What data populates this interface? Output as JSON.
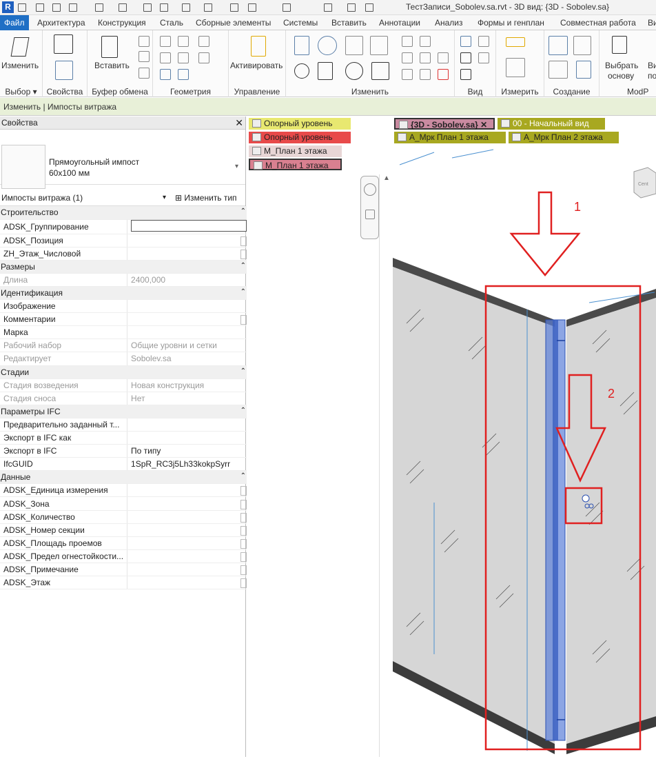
{
  "app": {
    "title": "ТестЗаписи_Sobolev.sa.rvt - 3D вид: {3D - Sobolev.sa}"
  },
  "tabs": [
    "Файл",
    "Архитектура",
    "Конструкция",
    "Сталь",
    "Сборные элементы",
    "Системы",
    "Вставить",
    "Аннотации",
    "Анализ",
    "Формы и генплан",
    "Совместная работа",
    "Ви"
  ],
  "ribbon": {
    "modify_label": "Изменить",
    "paste_label": "Вставить",
    "activate_label": "Активировать",
    "select_base_label1": "Выбрать",
    "select_base_label2": "основу",
    "vi_label1": "Ви",
    "vi_label2": "под",
    "panels": [
      "Выбор ▾",
      "Свойства",
      "Буфер обмена",
      "Геометрия",
      "Управление",
      "Изменить",
      "Вид",
      "Измерить",
      "Создание",
      "ModP"
    ]
  },
  "context_bar": "Изменить | Импосты витража",
  "properties": {
    "header": "Свойства",
    "type_name_line1": "Прямоугольный импост",
    "type_name_line2": "60x100 мм",
    "selection": "Импосты витража (1)",
    "edit_type": "Изменить тип",
    "rows": [
      {
        "g": "Строительство"
      },
      {
        "k": "ADSK_Группирование",
        "v": "",
        "edit": true
      },
      {
        "k": "ADSK_Позиция",
        "v": "",
        "chk": true
      },
      {
        "k": "ZH_Этаж_Числовой",
        "v": "",
        "chk": true
      },
      {
        "g": "Размеры"
      },
      {
        "k": "Длина",
        "v": "2400,000",
        "dim": true
      },
      {
        "g": "Идентификация"
      },
      {
        "k": "Изображение",
        "v": ""
      },
      {
        "k": "Комментарии",
        "v": "",
        "chk": true
      },
      {
        "k": "Марка",
        "v": ""
      },
      {
        "k": "Рабочий набор",
        "v": "Общие уровни и сетки",
        "dim": true
      },
      {
        "k": "Редактирует",
        "v": "Sobolev.sa",
        "dim": true
      },
      {
        "g": "Стадии"
      },
      {
        "k": "Стадия возведения",
        "v": "Новая конструкция",
        "dim": true
      },
      {
        "k": "Стадия сноса",
        "v": "Нет",
        "dim": true
      },
      {
        "g": "Параметры IFC"
      },
      {
        "k": "Предварительно заданный т...",
        "v": ""
      },
      {
        "k": "Экспорт в IFC как",
        "v": ""
      },
      {
        "k": "Экспорт в IFC",
        "v": "По типу"
      },
      {
        "k": "IfcGUID",
        "v": "1SpR_RC3j5Lh33kokpSyrr"
      },
      {
        "g": "Данные"
      },
      {
        "k": "ADSK_Единица измерения",
        "v": "",
        "chk": true
      },
      {
        "k": "ADSK_Зона",
        "v": "",
        "chk": true
      },
      {
        "k": "ADSK_Количество",
        "v": "",
        "chk": true
      },
      {
        "k": "ADSK_Номер секции",
        "v": "",
        "chk": true
      },
      {
        "k": "ADSK_Площадь проемов",
        "v": "",
        "chk": true
      },
      {
        "k": "ADSK_Предел огнестойкости...",
        "v": "",
        "chk": true
      },
      {
        "k": "ADSK_Примечание",
        "v": "",
        "chk": true
      },
      {
        "k": "ADSK_Этаж",
        "v": "",
        "chk": true
      }
    ]
  },
  "view_tabs": [
    {
      "label": "Опорный уровень",
      "color": "#e8e870"
    },
    {
      "label": "Опорный уровень",
      "color": "#e84a4a"
    },
    {
      "label": "М_План 1 этажа",
      "color": "#e8d6d6"
    },
    {
      "label": "М_План 1 этажа",
      "color": "#d98090"
    }
  ],
  "view_tabs_right": [
    {
      "label": "{3D - Sobolev.sa}",
      "color": "#c98aa0"
    },
    {
      "label": "00 - Начальный вид",
      "color": "#a8a820"
    },
    {
      "label": "А_Мрк План 1 этажа",
      "color": "#a8a820"
    },
    {
      "label": "А_Мрк План 2 этажа",
      "color": "#a8a820"
    }
  ],
  "annotations": {
    "one": "1",
    "two": "2"
  },
  "colors": {
    "annotation": "#e02020",
    "accent": "#1f6fc5",
    "context": "#e8f0d8"
  }
}
